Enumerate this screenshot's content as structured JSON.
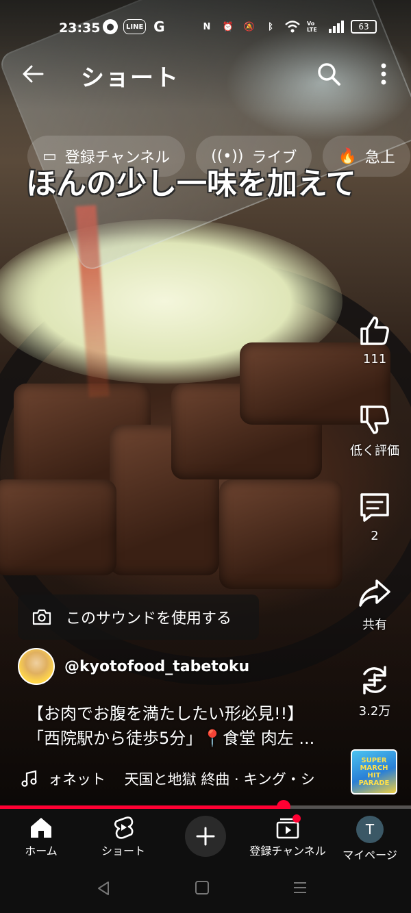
{
  "status_bar": {
    "time": "23:35",
    "line_label": "LINE",
    "g_label": "G",
    "volte_label": "Vo LTE",
    "battery": "63"
  },
  "topbar": {
    "title": "ショート"
  },
  "chips": [
    {
      "label": "登録チャンネル",
      "icon": "subscriptions-icon"
    },
    {
      "label": "ライブ",
      "icon": "live-icon"
    },
    {
      "label": "急上",
      "icon": "trending-icon"
    }
  ],
  "video": {
    "caption": "ほんの少し一味を加えて"
  },
  "actions": {
    "like_count": "111",
    "dislike_label": "低く評価",
    "comment_count": "2",
    "share_label": "共有",
    "remix_count": "3.2万"
  },
  "sound_button": {
    "label": "このサウンドを使用する"
  },
  "channel": {
    "handle": "@kyotofood_tabetoku"
  },
  "description": {
    "line1": "【お肉でお腹を満たしたい形必見!!】",
    "line2": "「西院駅から徒歩5分」📍食堂 肉左 ..."
  },
  "music": {
    "text": "ォネット　 天国と地獄 終曲 · キング・シ",
    "album_art_text": "SUPER MARCH HIT PARADE"
  },
  "playback": {
    "progress_fraction": 0.69
  },
  "bottom_nav": {
    "home": "ホーム",
    "shorts": "ショート",
    "subscriptions": "登録チャンネル",
    "mypage": "マイページ",
    "avatar_initial": "T"
  },
  "colors": {
    "accent": "#ff0033",
    "nav_bg": "#0f0f0f"
  }
}
